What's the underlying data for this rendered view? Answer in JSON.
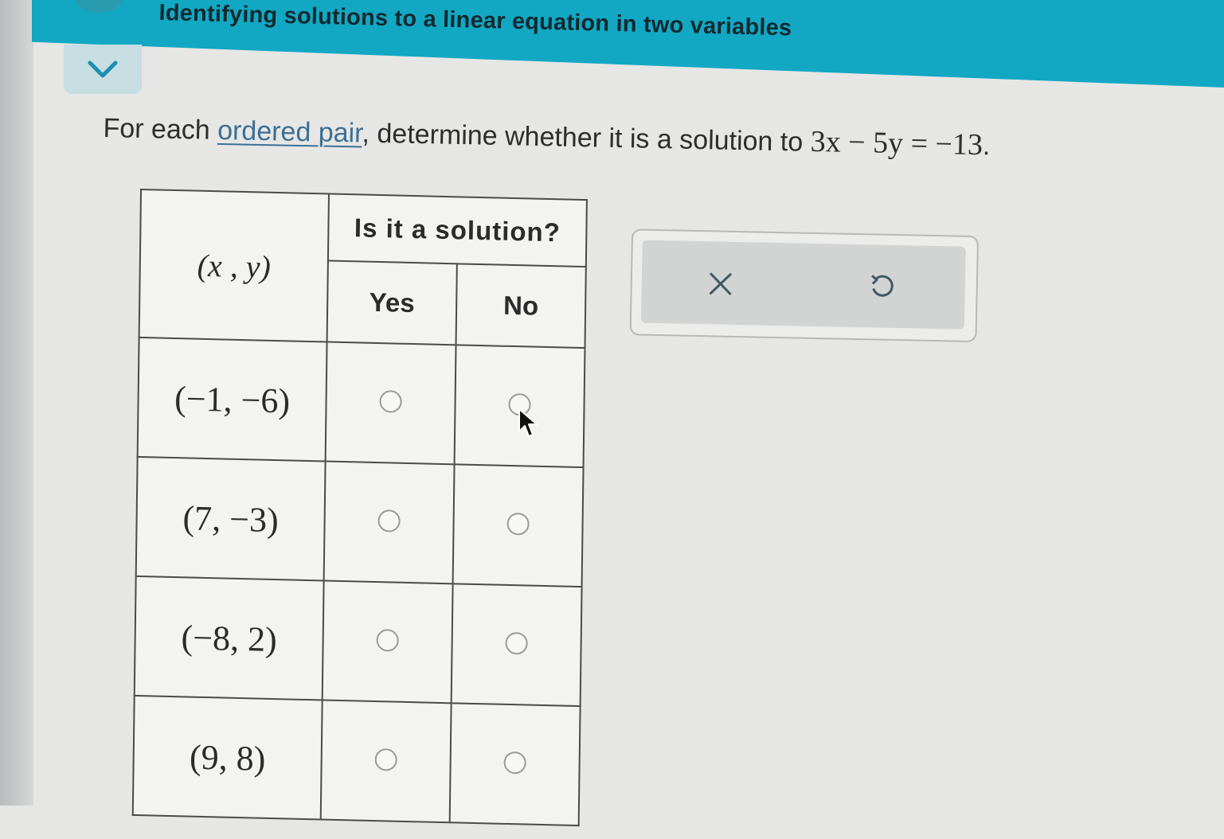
{
  "header": {
    "title": "Identifying solutions to a linear equation in two variables"
  },
  "prompt": {
    "before": "For each ",
    "link": "ordered pair",
    "after": ", determine whether it is a solution to ",
    "equation": "3x − 5y = −13",
    "end": "."
  },
  "table": {
    "pair_header": "(x , y)",
    "group_header": "Is it a solution?",
    "yes_header": "Yes",
    "no_header": "No",
    "rows": [
      {
        "pair": "(−1, −6)"
      },
      {
        "pair": "(7, −3)"
      },
      {
        "pair": "(−8, 2)"
      },
      {
        "pair": "(9, 8)"
      }
    ]
  },
  "tools": {
    "clear": "clear-icon",
    "undo": "undo-icon"
  },
  "colors": {
    "header": "#12a8c4",
    "link": "#3b6f95"
  }
}
